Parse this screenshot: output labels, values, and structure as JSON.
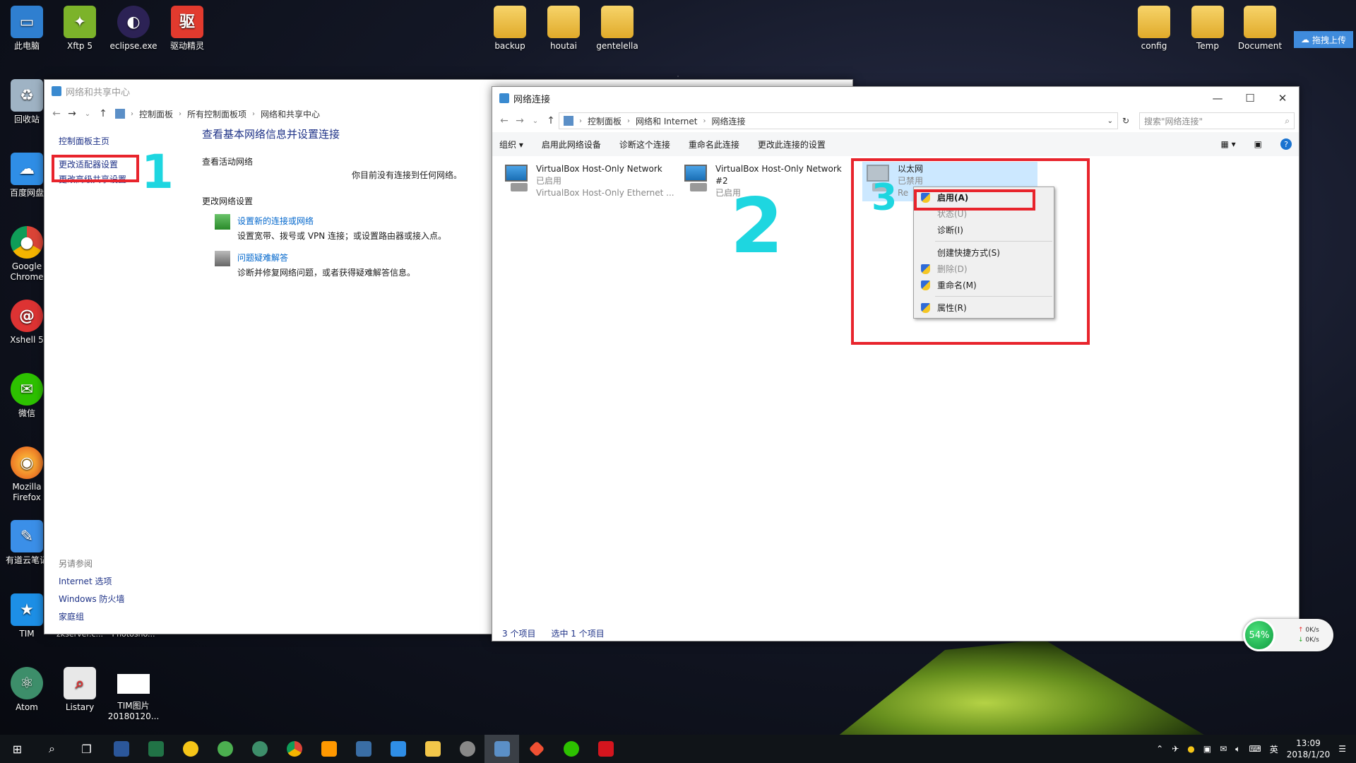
{
  "desktop": {
    "icons_left": [
      {
        "label": "此电脑"
      },
      {
        "label": "回收站"
      },
      {
        "label": "百度网盘"
      },
      {
        "label": "Google Chrome"
      },
      {
        "label": "Xshell 5"
      },
      {
        "label": "微信"
      },
      {
        "label": "Mozilla Firefox"
      },
      {
        "label": "有道云笔记"
      },
      {
        "label": "TIM"
      },
      {
        "label": "Atom"
      }
    ],
    "icons_top": [
      {
        "label": "Xftp 5"
      },
      {
        "label": "eclipse.exe"
      },
      {
        "label": "驱动精灵"
      },
      {
        "label": "backup"
      },
      {
        "label": "houtai"
      },
      {
        "label": "gentelella"
      },
      {
        "label": "config"
      },
      {
        "label": "Temp"
      },
      {
        "label": "Document"
      }
    ],
    "icons_bottom": [
      {
        "label": "Listary"
      },
      {
        "label": "TIM图片20180120..."
      },
      {
        "label": "zkserver.c..."
      },
      {
        "label": "Photosho..."
      }
    ],
    "upload_label": "拖拽上传"
  },
  "nsc_window": {
    "title": "网络和共享中心",
    "breadcrumbs": [
      "控制面板",
      "所有控制面板项",
      "网络和共享中心"
    ],
    "sidebar": [
      "控制面板主页",
      "更改适配器设置",
      "更改高级共享设置"
    ],
    "see_also_title": "另请参阅",
    "see_also": [
      "Internet 选项",
      "Windows 防火墙",
      "家庭组"
    ],
    "main_title": "查看基本网络信息并设置连接",
    "active_label": "查看活动网络",
    "no_network": "你目前没有连接到任何网络。",
    "change_label": "更改网络设置",
    "tasks": [
      {
        "title": "设置新的连接或网络",
        "desc": "设置宽带、拨号或 VPN 连接；或设置路由器或接入点。"
      },
      {
        "title": "问题疑难解答",
        "desc": "诊断并修复网络问题，或者获得疑难解答信息。"
      }
    ]
  },
  "nc_window": {
    "title": "网络连接",
    "breadcrumbs": [
      "控制面板",
      "网络和 Internet",
      "网络连接"
    ],
    "search_placeholder": "搜索\"网络连接\"",
    "toolbar": [
      "组织 ▾",
      "启用此网络设备",
      "诊断这个连接",
      "重命名此连接",
      "更改此连接的设置"
    ],
    "adapters": [
      {
        "name": "VirtualBox Host-Only Network",
        "status": "已启用",
        "device": "VirtualBox Host-Only Ethernet ..."
      },
      {
        "name": "VirtualBox Host-Only Network",
        "line2": "#2",
        "status": "已启用"
      },
      {
        "name": "以太网",
        "status": "已禁用",
        "device": "Re"
      }
    ],
    "status_count": "3 个项目",
    "status_selected": "选中 1 个项目"
  },
  "context_menu": {
    "items": [
      "启用(A)",
      "状态(U)",
      "诊断(I)",
      "创建快捷方式(S)",
      "删除(D)",
      "重命名(M)",
      "属性(R)"
    ]
  },
  "annotations": [
    "1",
    "2",
    "3"
  ],
  "gauge": {
    "percent": "54%",
    "up": "0K/s",
    "down": "0K/s"
  },
  "taskbar": {
    "time": "13:09",
    "date": "2018/1/20"
  },
  "colors": {
    "annotation_red": "#e8242c",
    "annotation_cyan": "#1ed6e0",
    "link_blue": "#1e3287"
  }
}
